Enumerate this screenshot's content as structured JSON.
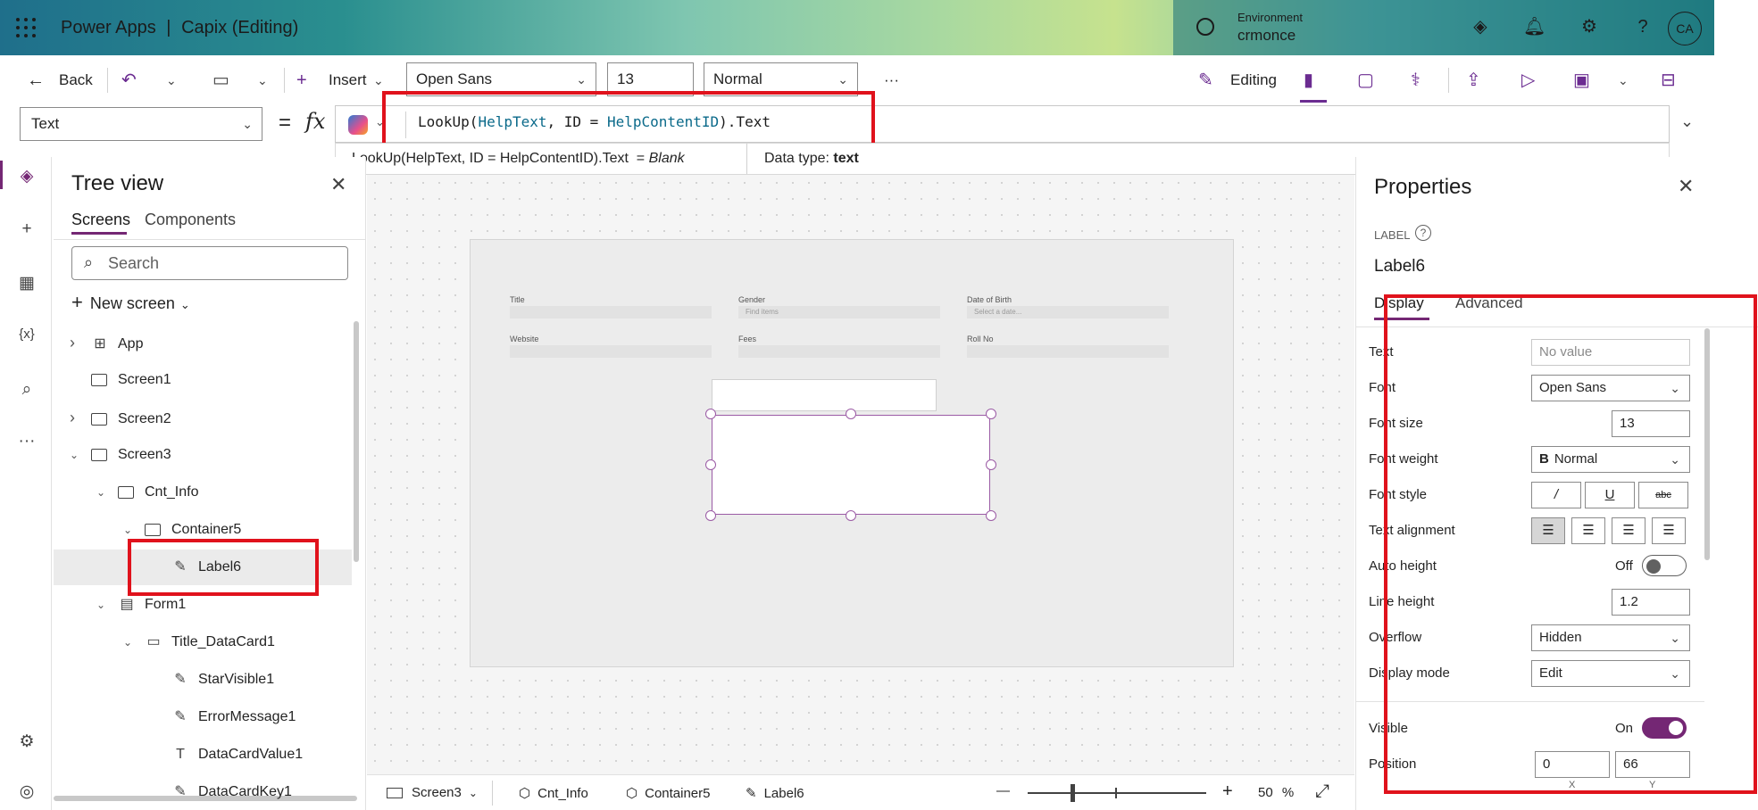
{
  "header": {
    "app_name": "Power Apps",
    "separator": "|",
    "app_title": "Capix (Editing)",
    "env_label": "Environment",
    "env_value": "crmonce",
    "avatar": "CA"
  },
  "toolbar": {
    "back": "Back",
    "insert": "Insert",
    "font": "Open Sans",
    "font_size": "13",
    "font_weight": "Normal",
    "more": "···",
    "editing": "Editing"
  },
  "formula_bar": {
    "property": "Text",
    "equals": "=",
    "fx": "fx",
    "formula_parts": [
      "LookUp(",
      "HelpText",
      ", ID = ",
      "HelpContentID",
      ").Text"
    ],
    "hint_expr": "LookUp(HelpText, ID = HelpContentID).Text  = ",
    "hint_value": "Blank",
    "data_type_label": "Data type:",
    "data_type": "text"
  },
  "tree": {
    "title": "Tree view",
    "tabs": [
      "Screens",
      "Components"
    ],
    "search_placeholder": "Search",
    "new_screen": "New screen",
    "nodes": [
      {
        "label": "App",
        "level": 0,
        "icon": "app-icon",
        "expanded": "collapsed"
      },
      {
        "label": "Screen1",
        "level": 0,
        "icon": "screen-icon",
        "expanded": "none"
      },
      {
        "label": "Screen2",
        "level": 0,
        "icon": "screen-icon",
        "expanded": "collapsed"
      },
      {
        "label": "Screen3",
        "level": 0,
        "icon": "screen-icon",
        "expanded": "expanded"
      },
      {
        "label": "Cnt_Info",
        "level": 1,
        "icon": "container-icon",
        "expanded": "expanded"
      },
      {
        "label": "Container5",
        "level": 2,
        "icon": "container-icon",
        "expanded": "expanded"
      },
      {
        "label": "Label6",
        "level": 3,
        "icon": "label-icon",
        "expanded": "none",
        "selected": true
      },
      {
        "label": "Form1",
        "level": 1,
        "icon": "form-icon",
        "expanded": "expanded"
      },
      {
        "label": "Title_DataCard1",
        "level": 2,
        "icon": "datacard-icon",
        "expanded": "expanded"
      },
      {
        "label": "StarVisible1",
        "level": 3,
        "icon": "label-icon",
        "expanded": "none"
      },
      {
        "label": "ErrorMessage1",
        "level": 3,
        "icon": "label-icon",
        "expanded": "none"
      },
      {
        "label": "DataCardValue1",
        "level": 3,
        "icon": "textinput-icon",
        "expanded": "none"
      },
      {
        "label": "DataCardKey1",
        "level": 3,
        "icon": "label-icon",
        "expanded": "none"
      }
    ]
  },
  "canvas": {
    "fields": [
      {
        "label": "Title",
        "placeholder": ""
      },
      {
        "label": "Gender",
        "placeholder": "Find items"
      },
      {
        "label": "Date of Birth",
        "placeholder": "Select a date..."
      },
      {
        "label": "Website",
        "placeholder": ""
      },
      {
        "label": "Fees",
        "placeholder": ""
      },
      {
        "label": "Roll No",
        "placeholder": ""
      }
    ]
  },
  "breadcrumb": {
    "items": [
      "Screen3",
      "Cnt_Info",
      "Container5",
      "Label6"
    ],
    "zoom_minus": "—",
    "zoom_plus": "+",
    "zoom": "50",
    "zoom_unit": "%"
  },
  "properties": {
    "title": "Properties",
    "type": "LABEL",
    "name": "Label6",
    "tabs": [
      "Display",
      "Advanced"
    ],
    "rows": {
      "text_label": "Text",
      "text_placeholder": "No value",
      "font_label": "Font",
      "font": "Open Sans",
      "font_size_label": "Font size",
      "font_size": "13",
      "font_weight_label": "Font weight",
      "font_weight": "Normal",
      "font_style_label": "Font style",
      "text_alignment_label": "Text alignment",
      "auto_height_label": "Auto height",
      "auto_height": "Off",
      "line_height_label": "Line height",
      "line_height": "1.2",
      "overflow_label": "Overflow",
      "overflow": "Hidden",
      "display_mode_label": "Display mode",
      "display_mode": "Edit",
      "visible_label": "Visible",
      "visible": "On",
      "position_label": "Position",
      "pos_x": "0",
      "pos_y": "66",
      "x_label": "X",
      "y_label": "Y"
    }
  },
  "colors": {
    "accent": "#742774",
    "highlight": "#e0121c"
  }
}
